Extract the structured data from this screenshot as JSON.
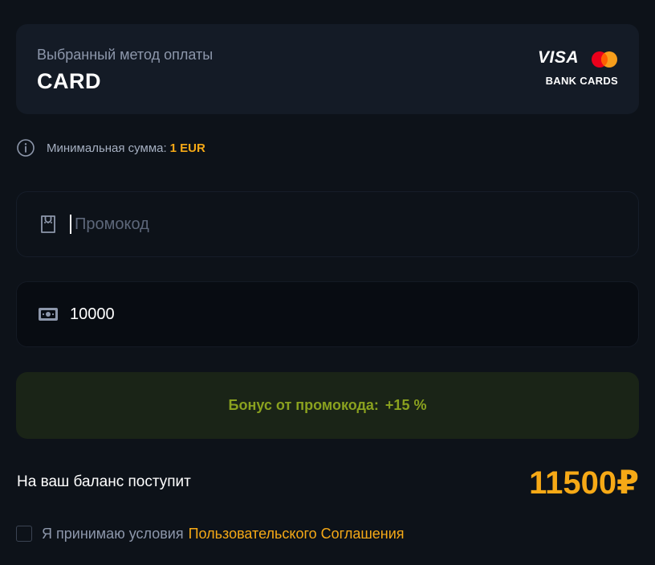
{
  "payment_method": {
    "label": "Выбранный метод оплаты",
    "name": "CARD",
    "logo": {
      "visa_text": "VISA",
      "subtitle": "BANK CARDS",
      "mastercard_colors": [
        "#eb001b",
        "#f79e1b"
      ]
    }
  },
  "minimum": {
    "icon": "info-icon",
    "label": "Минимальная сумма:",
    "value": "1 EUR"
  },
  "promo": {
    "icon": "ticket-icon",
    "placeholder": "Промокод",
    "value": ""
  },
  "amount": {
    "icon": "banknote-icon",
    "value": "10000"
  },
  "bonus": {
    "label": "Бонус от промокода:",
    "value": "+15 %"
  },
  "balance": {
    "label": "На ваш баланс поступит",
    "amount": "11500₽"
  },
  "terms": {
    "checked": false,
    "text": "Я принимаю условия",
    "link_text": "Пользовательского Соглашения"
  },
  "colors": {
    "accent": "#f6a916",
    "bonus_text": "#8aa11f",
    "background": "#0d1219"
  }
}
